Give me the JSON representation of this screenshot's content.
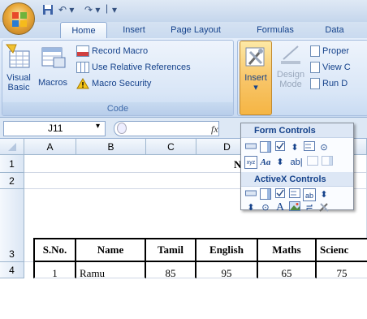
{
  "quick_access": {
    "save": "💾",
    "undo": "↶ ▾",
    "redo": "↷ ▾",
    "customize": "▾"
  },
  "tabs": [
    {
      "label": "Home"
    },
    {
      "label": "Insert"
    },
    {
      "label": "Page Layout"
    },
    {
      "label": "Formulas"
    },
    {
      "label": "Data"
    }
  ],
  "code_group": {
    "label": "Code",
    "visual_basic": "Visual\nBasic",
    "visual_basic_line1": "Visual",
    "visual_basic_line2": "Basic",
    "macros": "Macros",
    "record_macro": "Record Macro",
    "relative_refs": "Use Relative References",
    "macro_security": "Macro Security"
  },
  "controls_group": {
    "insert": "Insert",
    "design_mode_line1": "Design",
    "design_mode_line2": "Mode",
    "properties": "Proper",
    "view_code": "View C",
    "run_dialog": "Run D"
  },
  "formula_bar": {
    "cell_ref": "J11",
    "fx": "fx"
  },
  "dropdown": {
    "form_controls": "Form Controls",
    "activex_controls": "ActiveX Controls"
  },
  "columns": [
    "A",
    "B",
    "C",
    "D"
  ],
  "rows": [
    "1",
    "2",
    "3",
    "4"
  ],
  "table": {
    "headers": [
      "S.No.",
      "Name",
      "Tamil",
      "English",
      "Maths",
      "Scienc"
    ],
    "row1": [
      "1",
      "Ramu",
      "85",
      "95",
      "65",
      "75"
    ],
    "title_fragment": "N"
  }
}
